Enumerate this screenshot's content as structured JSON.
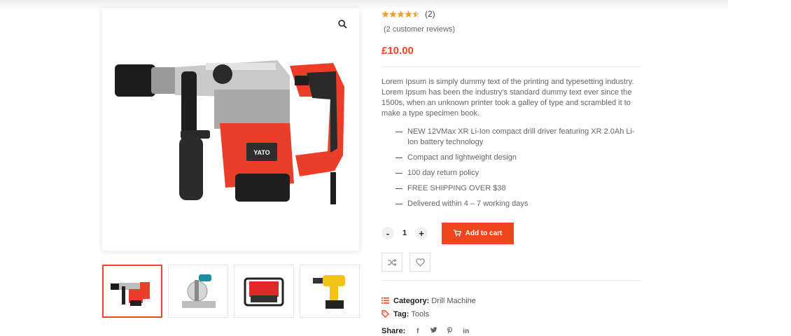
{
  "rating": {
    "value": 4.5,
    "max": 5,
    "count_text": "(2)",
    "reviews_link": "(2 customer reviews)"
  },
  "price": "£10.00",
  "description": "Lorem Ipsum is simply dummy text of the printing and typesetting industry. Lorem Ipsum has been the industry's standard dummy text ever since the 1500s, when an unknown printer took a galley of type and scrambled it to make a type specimen book.",
  "features": [
    "NEW 12VMax XR Li-Ion compact drill driver featuring XR 2.0Ah Li-Ion battery technology",
    "Compact and lightweight design",
    "100 day return policy",
    "FREE SHIPPING OVER $38",
    "Delivered within 4 – 7 working days"
  ],
  "cart": {
    "minus": "-",
    "qty": "1",
    "plus": "+",
    "add_label": "Add to cart"
  },
  "meta": {
    "category_label": "Category:",
    "category_value": "Drill Machine",
    "tag_label": "Tag:",
    "tag_value": "Tools"
  },
  "share": {
    "label": "Share:",
    "icons": [
      "facebook-icon",
      "twitter-icon",
      "pinterest-icon",
      "linkedin-icon"
    ]
  },
  "product_image": {
    "brand_text": "YATO"
  },
  "thumbnails": [
    "hammer-drill",
    "miter-saw",
    "generator",
    "cordless-drill"
  ],
  "colors": {
    "accent": "#ef4620",
    "star": "#f0a12a"
  }
}
